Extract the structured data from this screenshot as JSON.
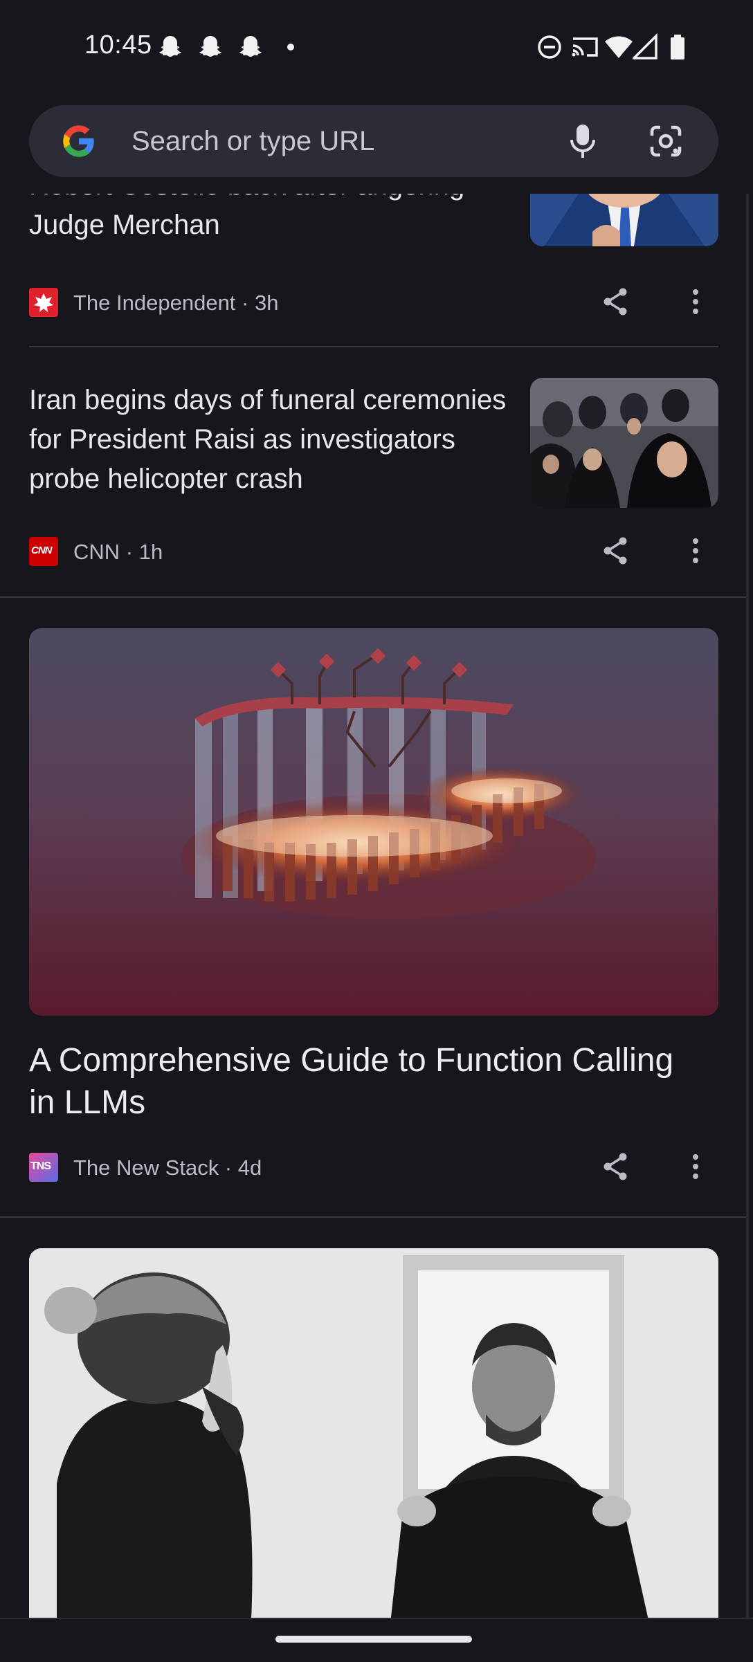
{
  "status": {
    "time": "10:45",
    "notification_icons": [
      "snapchat-icon",
      "snapchat-icon",
      "snapchat-icon",
      "dot-icon"
    ],
    "system_icons": [
      "do-not-disturb-icon",
      "cast-icon",
      "wifi-icon",
      "signal-icon",
      "battery-icon"
    ]
  },
  "search": {
    "placeholder": "Search or type URL"
  },
  "feed": {
    "articles": [
      {
        "headline_partial": "Robert Costello back after angering",
        "headline_line2": "Judge Merchan",
        "source": "The Independent",
        "age": "3h",
        "meta": "The Independent · 3h"
      },
      {
        "headline": "Iran begins days of funeral ceremonies for President Raisi as investigators probe helicopter crash",
        "source": "CNN",
        "age": "1h",
        "meta": "CNN · 1h",
        "logo_text": "CNN"
      },
      {
        "headline": "A Comprehensive Guide to Function Calling in LLMs",
        "source": "The New Stack",
        "age": "4d",
        "meta": "The New Stack · 4d",
        "logo_text": "TNS"
      }
    ]
  },
  "colors": {
    "background": "#16161c",
    "search_bar": "#2c2c36",
    "divider": "#3a3a44",
    "cnn_red": "#cc0000",
    "independent_red": "#e0202b"
  }
}
